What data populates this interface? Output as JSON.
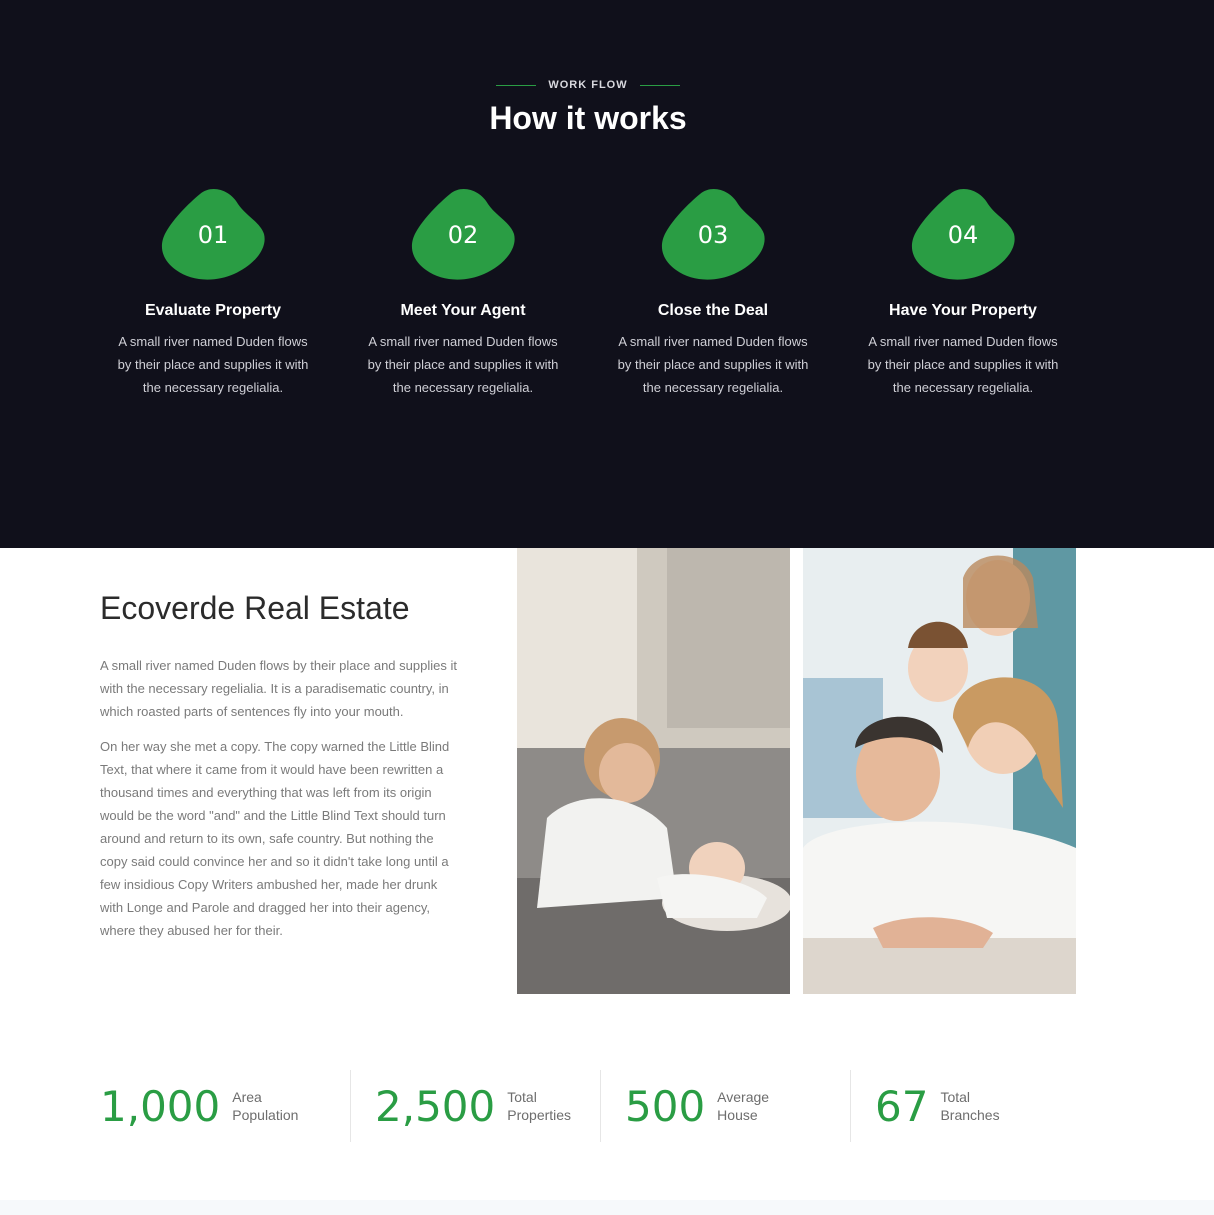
{
  "works": {
    "eyebrow": "WORK FLOW",
    "title": "How it works",
    "accent_color": "#2a9d44",
    "steps": [
      {
        "number": "01",
        "title": "Evaluate Property",
        "text": "A small river named Duden flows by their place and supplies it with the necessary regelialia."
      },
      {
        "number": "02",
        "title": "Meet Your Agent",
        "text": "A small river named Duden flows by their place and supplies it with the necessary regelialia."
      },
      {
        "number": "03",
        "title": "Close the Deal",
        "text": "A small river named Duden flows by their place and supplies it with the necessary regelialia."
      },
      {
        "number": "04",
        "title": "Have Your Property",
        "text": "A small river named Duden flows by their place and supplies it with the necessary regelialia."
      }
    ]
  },
  "about": {
    "title": "Ecoverde Real Estate",
    "paragraph1": "A small river named Duden flows by their place and supplies it with the necessary regelialia. It is a paradisematic country, in which roasted parts of sentences fly into your mouth.",
    "paragraph2": "On her way she met a copy. The copy warned the Little Blind Text, that where it came from it would have been rewritten a thousand times and everything that was left from its origin would be the word \"and\" and the Little Blind Text should turn around and return to its own, safe country. But nothing the copy said could convince her and so it didn't take long until a few insidious Copy Writers ambushed her, made her drunk with Longe and Parole and dragged her into their agency, where they abused her for their."
  },
  "stats": [
    {
      "value": "1,000",
      "label": "Area Population"
    },
    {
      "value": "2,500",
      "label": "Total Properties"
    },
    {
      "value": "500",
      "label": "Average House"
    },
    {
      "value": "67",
      "label": "Total Branches"
    }
  ]
}
